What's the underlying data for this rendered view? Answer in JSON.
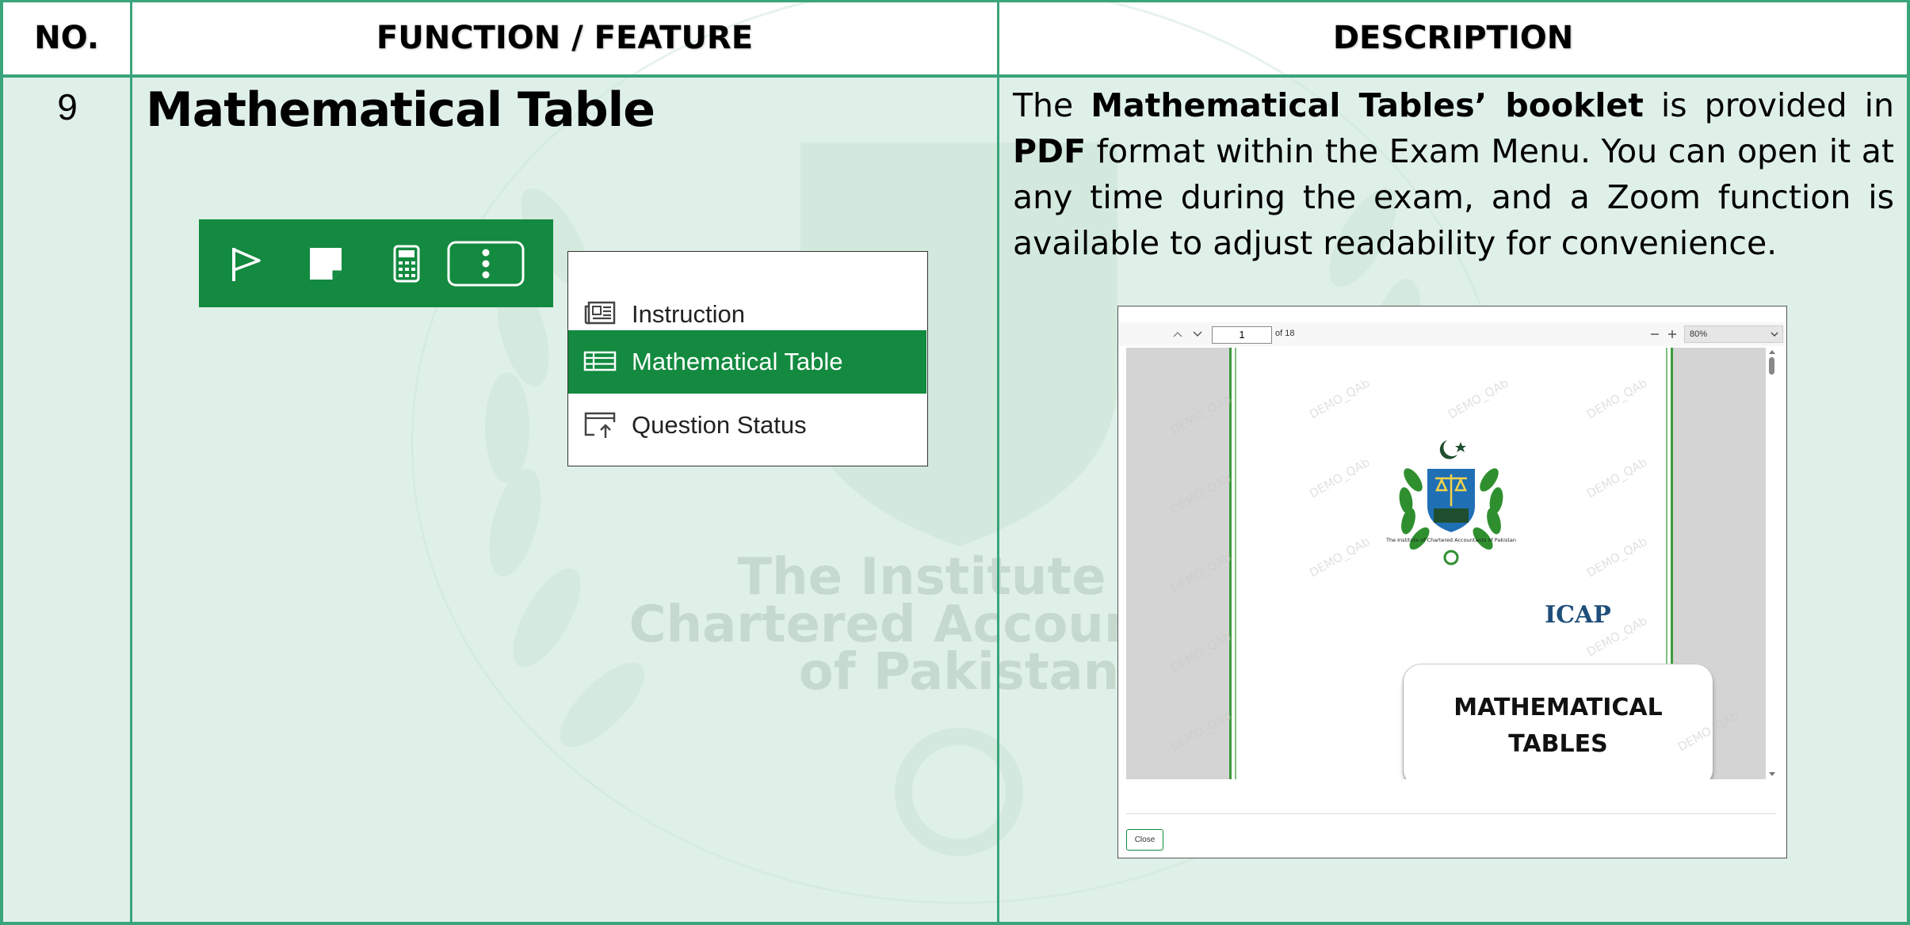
{
  "header": {
    "col_no": "NO.",
    "col_feature": "FUNCTION / FEATURE",
    "col_description": "DESCRIPTION"
  },
  "row": {
    "number": "9",
    "feature_title": "Mathematical Table",
    "description": {
      "p1": "The ",
      "b1": "Mathematical Tables’ booklet",
      "p2": " is provided in ",
      "b2": "PDF",
      "p3": " format within the Exam Menu. You can open it at any time during the exam, and a Zoom function is available to adjust readability for convenience."
    }
  },
  "watermark": {
    "line1": "The Institute of",
    "line2": "Chartered Accountants",
    "line3": "of Pakistan"
  },
  "toolbar": {
    "icons": [
      "flag-icon",
      "note-icon",
      "calculator-icon",
      "more-options-icon"
    ],
    "accent": "#138a3f"
  },
  "exam_menu": {
    "items": [
      {
        "label": "Instruction",
        "icon": "instruction-icon",
        "active": false
      },
      {
        "label": "Mathematical Table",
        "icon": "table-icon",
        "active": true
      },
      {
        "label": "Question Status",
        "icon": "question-status-icon",
        "active": false
      }
    ]
  },
  "pdf_viewer": {
    "page_value": "1",
    "page_of": "of 18",
    "zoom": "80%",
    "close_label": "Close",
    "watermark_text": "DEMO_QAb",
    "page": {
      "logo_text": "ICAP",
      "seal_text": "The Institute of Chartered Accountants of Pakistan",
      "title_line1": "MATHEMATICAL",
      "title_line2": "TABLES"
    }
  },
  "colors": {
    "table_border": "#3aa47a",
    "row_background": "#dff0e8",
    "brand_green": "#138a3f"
  }
}
